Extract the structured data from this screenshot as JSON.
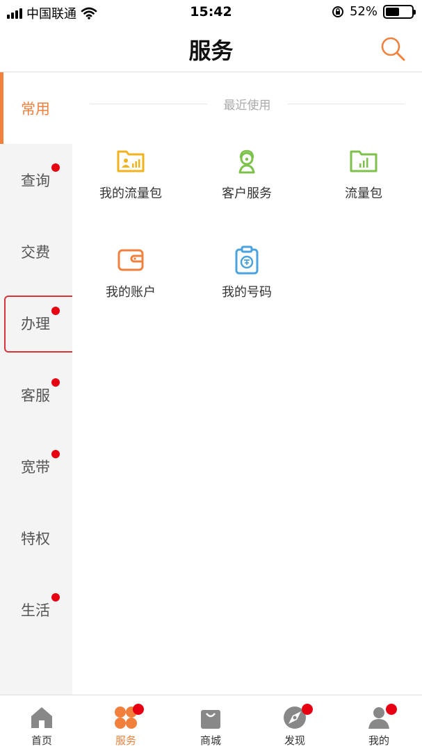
{
  "status_bar": {
    "carrier": "中国联通",
    "time": "15:42",
    "battery": "52%",
    "battery_level": 0.52
  },
  "header": {
    "title": "服务",
    "search_icon": "search-icon"
  },
  "sidebar": {
    "items": [
      {
        "label": "常用",
        "active": true,
        "dot": false,
        "boxed": false
      },
      {
        "label": "查询",
        "active": false,
        "dot": true,
        "boxed": false
      },
      {
        "label": "交费",
        "active": false,
        "dot": false,
        "boxed": false
      },
      {
        "label": "办理",
        "active": false,
        "dot": true,
        "boxed": true
      },
      {
        "label": "客服",
        "active": false,
        "dot": true,
        "boxed": false
      },
      {
        "label": "宽带",
        "active": false,
        "dot": true,
        "boxed": false
      },
      {
        "label": "特权",
        "active": false,
        "dot": false,
        "boxed": false
      },
      {
        "label": "生活",
        "active": false,
        "dot": true,
        "boxed": false
      }
    ]
  },
  "content": {
    "section_title": "最近使用",
    "items": [
      {
        "label": "我的流量包",
        "icon": "folder-chart-icon",
        "color": "#f2b21c"
      },
      {
        "label": "客户服务",
        "icon": "agent-icon",
        "color": "#7cc24a"
      },
      {
        "label": "流量包",
        "icon": "folder-bars-icon",
        "color": "#7cc24a"
      },
      {
        "label": "我的账户",
        "icon": "wallet-icon",
        "color": "#f0803c"
      },
      {
        "label": "我的号码",
        "icon": "clipboard-icon",
        "color": "#4aa3df"
      }
    ]
  },
  "tabbar": {
    "tabs": [
      {
        "label": "首页",
        "icon": "home-icon",
        "active": false,
        "dot": false
      },
      {
        "label": "服务",
        "icon": "service-icon",
        "active": true,
        "dot": true
      },
      {
        "label": "商城",
        "icon": "shopping-bag-icon",
        "active": false,
        "dot": false
      },
      {
        "label": "发现",
        "icon": "compass-icon",
        "active": false,
        "dot": true
      },
      {
        "label": "我的",
        "icon": "user-icon",
        "active": false,
        "dot": true
      }
    ]
  },
  "colors": {
    "accent": "#f0803c",
    "badge": "#e60012",
    "highlight_box": "#d9333a"
  }
}
